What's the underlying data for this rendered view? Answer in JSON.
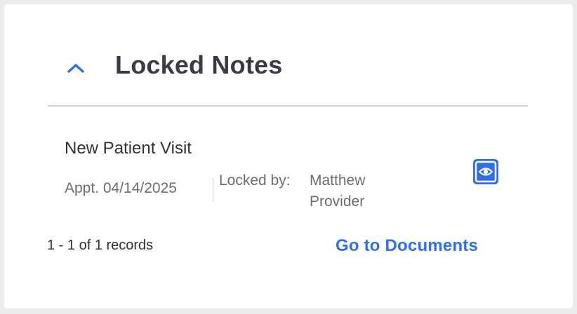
{
  "panel": {
    "title": "Locked Notes",
    "collapse_icon": "chevron-up-icon",
    "accent_color": "#2f6fe8"
  },
  "notes": [
    {
      "title": "New Patient Visit",
      "appt": "Appt. 04/14/2025",
      "locked_by_label": "Locked by:",
      "locked_by_name": "Matthew Provider",
      "view_icon": "eye-icon"
    }
  ],
  "footer": {
    "records": "1 - 1 of 1 records",
    "link_label": "Go to Documents"
  }
}
